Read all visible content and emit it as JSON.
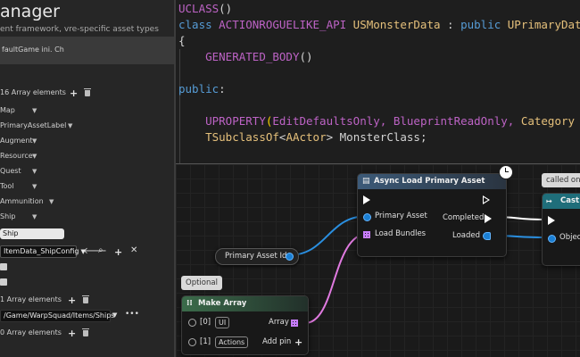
{
  "left_panel": {
    "title": "anager",
    "subtitle": "ent framework, vre-specific asset types",
    "ini_label": "faultGame ini. Ch",
    "array1_label": "16 Array elements",
    "items": [
      {
        "label": "Map"
      },
      {
        "label": "PrimaryAssetLabel"
      },
      {
        "label": "Augment"
      },
      {
        "label": "Resource"
      },
      {
        "label": "Quest"
      },
      {
        "label": "Tool"
      },
      {
        "label": "Ammunition"
      },
      {
        "label": "Ship"
      }
    ],
    "ship_value": "Ship",
    "config_value": "ItemData_ShipConfig",
    "array2_label": "1 Array elements",
    "path_value": "/Game/WarpSquad/Items/Ships",
    "array3_label": "0 Array elements"
  },
  "code": {
    "lines": [
      [
        {
          "t": "UCLASS",
          "c": "macro"
        },
        {
          "t": "()",
          "c": "pl"
        }
      ],
      [
        {
          "t": "class ",
          "c": "kw"
        },
        {
          "t": "ACTIONROGUELIKE_API ",
          "c": "macro"
        },
        {
          "t": "USMonsterData",
          "c": "type"
        },
        {
          "t": " : ",
          "c": "pl"
        },
        {
          "t": "public ",
          "c": "kw"
        },
        {
          "t": "UPrimaryDataAsset",
          "c": "type"
        }
      ],
      [
        {
          "t": "{",
          "c": "pl"
        }
      ],
      [
        {
          "t": "    ",
          "c": "pl"
        },
        {
          "t": "GENERATED_BODY",
          "c": "macro"
        },
        {
          "t": "()",
          "c": "pl"
        }
      ],
      [
        {
          "t": "",
          "c": "pl"
        }
      ],
      [
        {
          "t": "public",
          "c": "kw"
        },
        {
          "t": ":",
          "c": "pl"
        }
      ],
      [
        {
          "t": "",
          "c": "pl"
        }
      ],
      [
        {
          "t": "    ",
          "c": "pl"
        },
        {
          "t": "UPROPERTY",
          "c": "macro"
        },
        {
          "t": "(",
          "c": "paren"
        },
        {
          "t": "EditDefaultsOnly, BlueprintReadOnly, ",
          "c": "macro"
        },
        {
          "t": "Category",
          "c": "type"
        }
      ],
      [
        {
          "t": "    ",
          "c": "pl"
        },
        {
          "t": "TSubclassOf",
          "c": "type"
        },
        {
          "t": "<",
          "c": "pl"
        },
        {
          "t": "AActor",
          "c": "type"
        },
        {
          "t": "> MonsterClass;",
          "c": "pl"
        }
      ]
    ]
  },
  "graph": {
    "async_node": {
      "title": "Async Load Primary Asset",
      "pin_primary_asset": "Primary Asset",
      "pin_load_bundles": "Load Bundles",
      "pin_completed": "Completed",
      "pin_loaded": "Loaded"
    },
    "primary_asset_id": "Primary Asset Id",
    "optional_comment": "Optional",
    "called_comment": "called on",
    "make_array": {
      "title": "Make Array",
      "item0_index": "[0]",
      "item0_value": "UI",
      "item1_index": "[1]",
      "item1_value": "Actions",
      "array_label": "Array",
      "add_pin": "Add pin"
    },
    "cast_node": {
      "title": "Cast",
      "pin_object": "Objec"
    }
  },
  "colors": {
    "async_header": "#3c5a78",
    "make_array_header": "#3b6b4a",
    "cast_header": "#1f6e7a",
    "wire_blue": "#2a8fe0",
    "wire_pink": "#e07ae0"
  }
}
